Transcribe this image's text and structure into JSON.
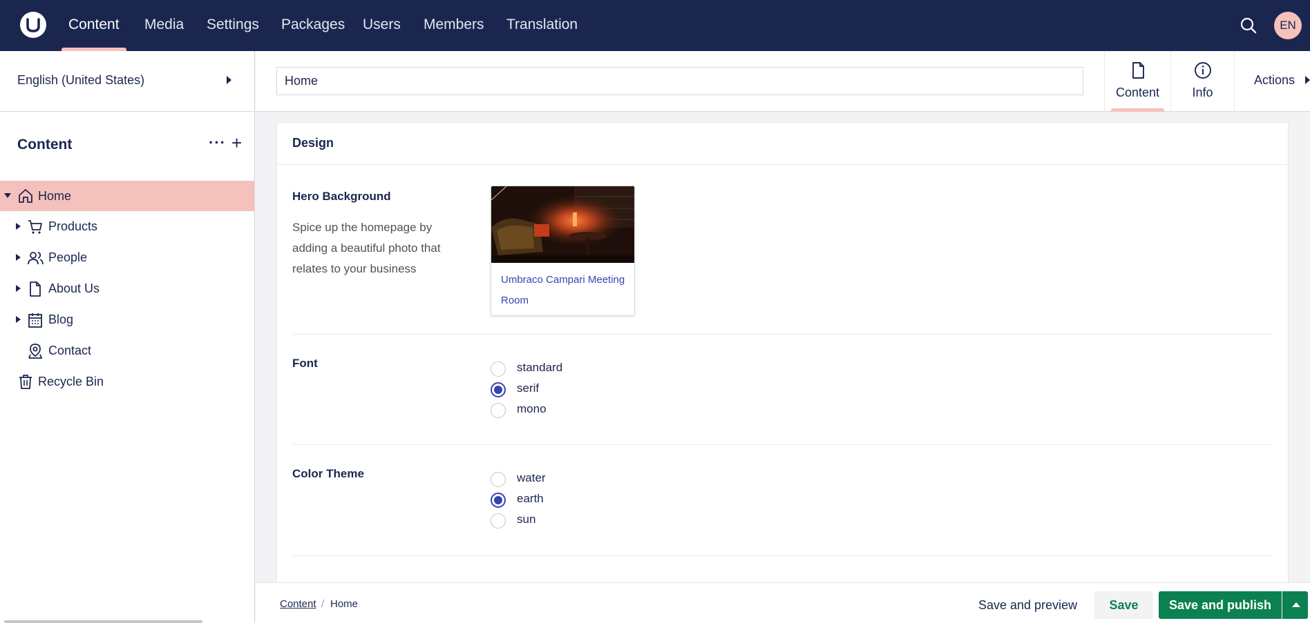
{
  "colors": {
    "topbar_bg": "#1b264f",
    "accent_pink": "#f5c1bc",
    "radio_selected": "#3544b1",
    "publish_green": "#0b8152",
    "text": "#1b264f"
  },
  "topnav": {
    "logo_icon": "umbraco-logo-icon",
    "items": [
      {
        "label": "Content",
        "active": true
      },
      {
        "label": "Media",
        "active": false
      },
      {
        "label": "Settings",
        "active": false
      },
      {
        "label": "Packages",
        "active": false
      },
      {
        "label": "Users",
        "active": false
      },
      {
        "label": "Members",
        "active": false
      },
      {
        "label": "Translation",
        "active": false
      }
    ],
    "search_icon": "search-icon",
    "avatar_initials": "EN"
  },
  "sidebar": {
    "language": "English (United States)",
    "tree_title": "Content",
    "more_icon": "ellipsis-icon",
    "add_icon": "plus-icon",
    "items": [
      {
        "label": "Home",
        "icon": "home-icon",
        "expanded": true,
        "active": true
      },
      {
        "label": "Products",
        "icon": "cart-icon",
        "expanded": false,
        "active": false
      },
      {
        "label": "People",
        "icon": "users-icon",
        "expanded": false,
        "active": false
      },
      {
        "label": "About Us",
        "icon": "document-icon",
        "expanded": false,
        "active": false
      },
      {
        "label": "Blog",
        "icon": "calendar-icon",
        "expanded": false,
        "active": false
      },
      {
        "label": "Contact",
        "icon": "map-pin-icon",
        "expanded": null,
        "active": false
      },
      {
        "label": "Recycle Bin",
        "icon": "trash-icon",
        "expanded": null,
        "active": false
      }
    ]
  },
  "header": {
    "node_name": "Home",
    "apps": [
      {
        "label": "Content",
        "icon": "document-icon",
        "active": true
      },
      {
        "label": "Info",
        "icon": "info-icon",
        "active": false
      }
    ],
    "actions_label": "Actions"
  },
  "editor": {
    "group_title": "Design",
    "hero": {
      "label": "Hero Background",
      "description": "Spice up the homepage by adding a beautiful photo that relates to your business",
      "media_name": "Umbraco Campari Meeting Room"
    },
    "font": {
      "label": "Font",
      "options": [
        "standard",
        "serif",
        "mono"
      ],
      "selected": "serif"
    },
    "color_theme": {
      "label": "Color Theme",
      "options": [
        "water",
        "earth",
        "sun"
      ],
      "selected": "earth"
    }
  },
  "footer": {
    "breadcrumb": [
      "Content",
      "Home"
    ],
    "separator": "/",
    "save_preview_label": "Save and preview",
    "save_label": "Save",
    "publish_label": "Save and publish"
  }
}
